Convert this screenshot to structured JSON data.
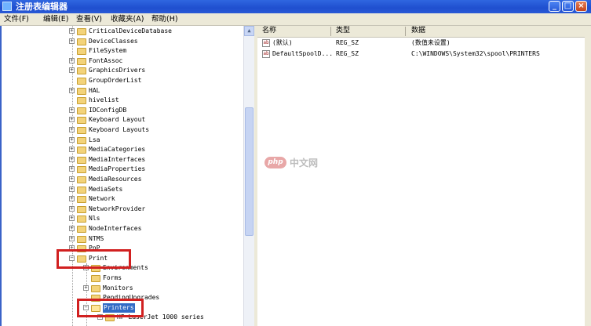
{
  "window": {
    "title": "注册表编辑器"
  },
  "menu": [
    "文件(F)",
    "编辑(E)",
    "查看(V)",
    "收藏夹(A)",
    "帮助(H)"
  ],
  "tree": {
    "items": [
      {
        "label": "CriticalDeviceDatabase",
        "expander": "+"
      },
      {
        "label": "DeviceClasses",
        "expander": "+"
      },
      {
        "label": "FileSystem",
        "expander": ""
      },
      {
        "label": "FontAssoc",
        "expander": "+"
      },
      {
        "label": "GraphicsDrivers",
        "expander": "+"
      },
      {
        "label": "GroupOrderList",
        "expander": ""
      },
      {
        "label": "HAL",
        "expander": "+"
      },
      {
        "label": "hivelist",
        "expander": ""
      },
      {
        "label": "IDConfigDB",
        "expander": "+"
      },
      {
        "label": "Keyboard Layout",
        "expander": "+"
      },
      {
        "label": "Keyboard Layouts",
        "expander": "+"
      },
      {
        "label": "Lsa",
        "expander": "+"
      },
      {
        "label": "MediaCategories",
        "expander": "+"
      },
      {
        "label": "MediaInterfaces",
        "expander": "+"
      },
      {
        "label": "MediaProperties",
        "expander": "+"
      },
      {
        "label": "MediaResources",
        "expander": "+"
      },
      {
        "label": "MediaSets",
        "expander": "+"
      },
      {
        "label": "Network",
        "expander": "+"
      },
      {
        "label": "NetworkProvider",
        "expander": "+"
      },
      {
        "label": "Nls",
        "expander": "+"
      },
      {
        "label": "NodeInterfaces",
        "expander": "+"
      },
      {
        "label": "NTMS",
        "expander": "+"
      },
      {
        "label": "PnP",
        "expander": "+"
      },
      {
        "label": "Print",
        "expander": "-"
      },
      {
        "label": "Environments",
        "expander": "+"
      },
      {
        "label": "Forms",
        "expander": ""
      },
      {
        "label": "Monitors",
        "expander": "+"
      },
      {
        "label": "PendingUpgrades",
        "expander": ""
      },
      {
        "label": "Printers",
        "expander": "-"
      },
      {
        "label": "HP LaserJet 1000 series",
        "expander": "+"
      }
    ]
  },
  "values": {
    "headers": [
      "名称",
      "类型",
      "数据"
    ],
    "rows": [
      {
        "name": "(默认)",
        "type": "REG_SZ",
        "data": "(数值未设置)"
      },
      {
        "name": "DefaultSpoolD...",
        "type": "REG_SZ",
        "data": "C:\\WINDOWS\\System32\\spool\\PRINTERS"
      }
    ]
  },
  "watermark": {
    "badge": "php",
    "text": "中文网"
  },
  "colors": {
    "titlebar": "#2459d6",
    "selection": "#316ac5",
    "highlight_box": "#d12020",
    "folder": "#f3d37a"
  }
}
